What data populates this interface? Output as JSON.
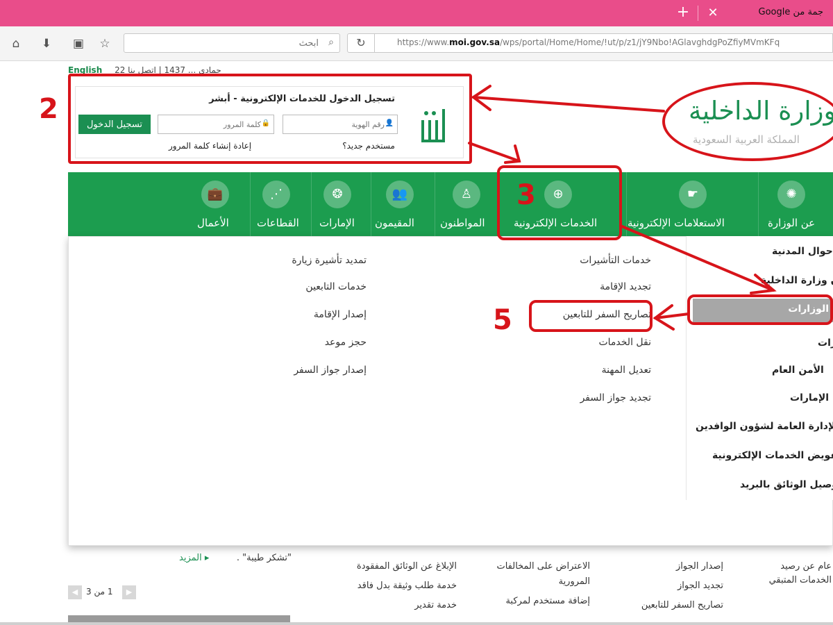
{
  "browser": {
    "tab_title": "جمة من Google",
    "search_placeholder": "ابحث",
    "url_prefix": "https://www.",
    "url_domain": "moi.gov.sa",
    "url_path": "/wps/portal/Home/Home/!ut/p/z1/jY9Nbo!AGlavghdgPoZfiyMVmKFq"
  },
  "header": {
    "top_links": "22 جمادى ...  1437  |  اتصل بنا",
    "english_link": "English",
    "ministry_name": "وزارة الداخلية",
    "ministry_sub": "المملكة العربية السعودية"
  },
  "login": {
    "title": "تسجيل الدخول للخدمات الإلكترونية - أبشر",
    "id_placeholder": "رقم الهوية",
    "password_placeholder": "كلمة المرور",
    "login_button": "تسجيل الدخول",
    "new_user": "مستخدم جديد؟",
    "create_password": "إعادة إنشاء كلمة المرور"
  },
  "nav": {
    "items": [
      {
        "label": "عن الوزارة",
        "icon": "emblem-icon"
      },
      {
        "label": "الاستعلامات الإلكترونية",
        "icon": "hand-icon"
      },
      {
        "label": "الخدمات الإلكترونية",
        "icon": "globe-icon"
      },
      {
        "label": "المواطنون",
        "icon": "citizen-icon"
      },
      {
        "label": "المقيمون",
        "icon": "people-icon"
      },
      {
        "label": "الإمارات",
        "icon": "regions-icon"
      },
      {
        "label": "القطاعات",
        "icon": "network-icon"
      },
      {
        "label": "الأعمال",
        "icon": "briefcase-icon"
      }
    ]
  },
  "dropdown": {
    "col1": [
      "خدمات التأشيرات",
      "تجديد الإقامة",
      "تصاريح السفر للتابعين",
      "نقل الخدمات",
      "تعديل المهنة",
      "تجديد جواز السفر"
    ],
    "col2": [
      "تمديد تأشيرة زيارة",
      "خدمات التابعين",
      "إصدار الإقامة",
      "حجز موعد",
      "إصدار جواز السفر"
    ],
    "side": [
      "الأحوال المدنية",
      "ديوان وزارة الداخلية",
      "الوزارات",
      "الجوازات",
      "الأمن العام",
      "الإمارات",
      "الإدارة العامة لشؤون الوافدين",
      "تفويض الخدمات الإلكترونية",
      "توصيل الوثائق بالبريد"
    ]
  },
  "below": {
    "text1": "\"تشكر طيبة\" .",
    "more": "المزيد",
    "pager": "1 من 3",
    "col_a": [
      "الإبلاغ عن الوثائق المفقودة",
      "خدمة طلب وثيقة بدل فاقد",
      "خدمة تقدير"
    ],
    "col_b": [
      "الاعتراض على المخالفات",
      "المرورية",
      "إضافة مستخدم لمركبة"
    ],
    "col_c": [
      "إصدار الجواز",
      "تجديد الجواز",
      "تصاريح السفر للتابعين"
    ],
    "col_d": [
      "عام عن رصيد",
      "الخدمات المتبقي"
    ]
  },
  "annotations": [
    "2",
    "3",
    "5"
  ],
  "colors": {
    "green": "#1c9d4f",
    "annotation_red": "#d7141a",
    "tab_pink": "#e94d8a"
  }
}
